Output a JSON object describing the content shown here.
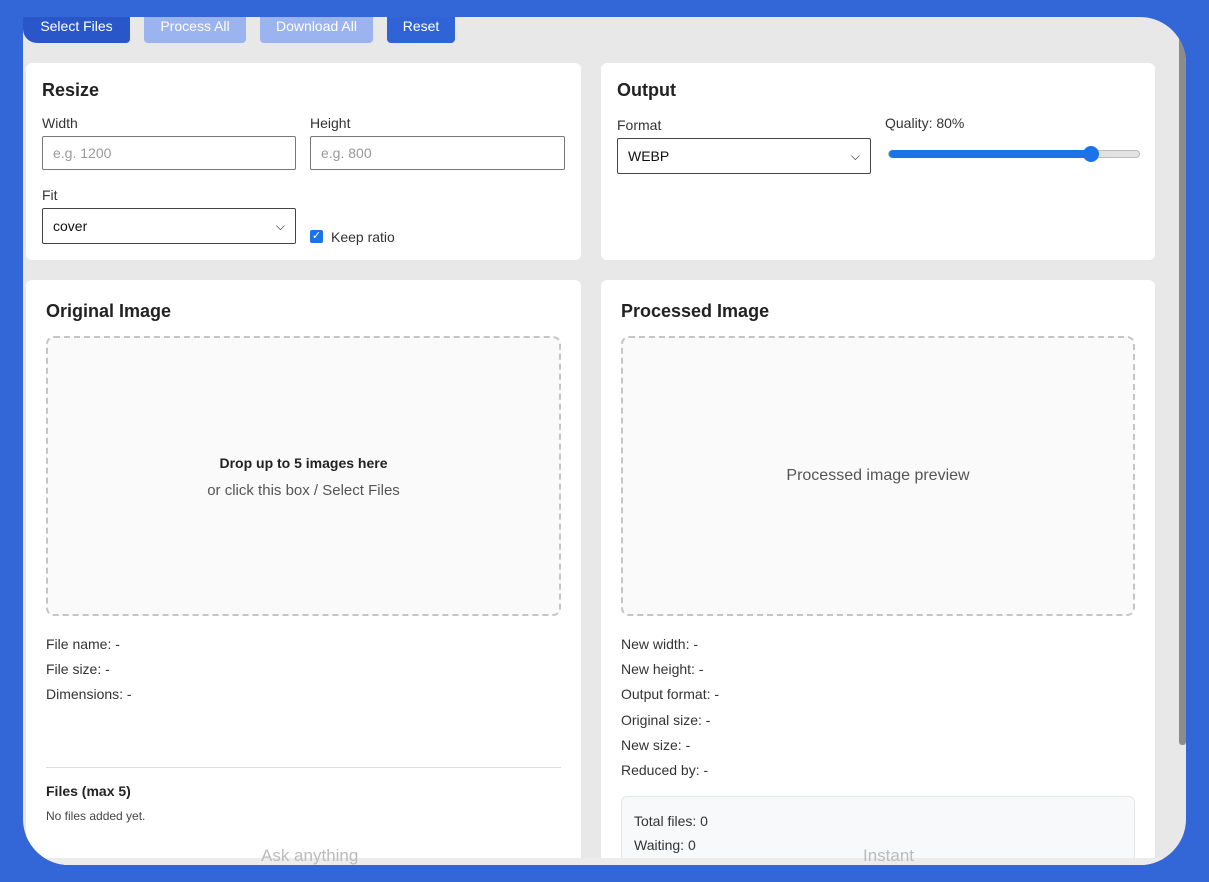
{
  "toolbar": {
    "select_files": "Select Files",
    "process_all": "Process All",
    "download_all": "Download All",
    "reset": "Reset"
  },
  "resize": {
    "title": "Resize",
    "width_label": "Width",
    "width_placeholder": "e.g. 1200",
    "height_label": "Height",
    "height_placeholder": "e.g. 800",
    "fit_label": "Fit",
    "fit_value": "cover",
    "keep_ratio_label": "Keep ratio",
    "keep_ratio_checked": true
  },
  "output": {
    "title": "Output",
    "format_label": "Format",
    "format_value": "WEBP",
    "quality_label": "Quality: 80%",
    "quality_value": 0.8
  },
  "original": {
    "title": "Original Image",
    "drop_title": "Drop up to 5 images here",
    "drop_sub": "or click this box / Select Files",
    "file_name": "File name: -",
    "file_size": "File size: -",
    "dimensions": "Dimensions: -",
    "files_title": "Files (max 5)",
    "files_empty": "No files added yet."
  },
  "processed": {
    "title": "Processed Image",
    "preview": "Processed image preview",
    "new_width": "New width: -",
    "new_height": "New height: -",
    "output_format": "Output format: -",
    "original_size": "Original size: -",
    "new_size": "New size: -",
    "reduced_by": "Reduced by: -",
    "total_files": "Total files: 0",
    "waiting": "Waiting: 0"
  },
  "background_text": {
    "ask": "Ask anything",
    "instant": "Instant"
  },
  "colors": {
    "accent": "#1a73e8",
    "primary_button": "#2956c8",
    "disabled_button": "#9bb3ef",
    "background": "#3366d6"
  }
}
